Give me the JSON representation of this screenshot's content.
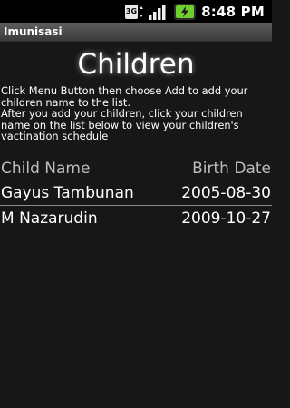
{
  "status_bar": {
    "time": "8:48 PM",
    "icons": [
      "data-3g-icon",
      "signal-icon",
      "battery-icon"
    ],
    "network_badge": "3G"
  },
  "app": {
    "title": "Imunisasi"
  },
  "page": {
    "heading": "Children",
    "instructions": [
      "Click Menu Button then choose Add to add your children name to the list.",
      "After you add your children, click your children name on the list below to view your children's vactination schedule"
    ]
  },
  "list": {
    "headers": {
      "name": "Child Name",
      "birth_date": "Birth Date"
    },
    "rows": [
      {
        "name": "Gayus Tambunan",
        "birth_date": "2005-08-30"
      },
      {
        "name": "M Nazarudin",
        "birth_date": "2009-10-27"
      }
    ]
  },
  "colors": {
    "background": "#171717",
    "status_bar": "#000000",
    "header_text": "#bdbdbd",
    "text": "#ffffff",
    "battery_green": "#6fcf2e"
  }
}
